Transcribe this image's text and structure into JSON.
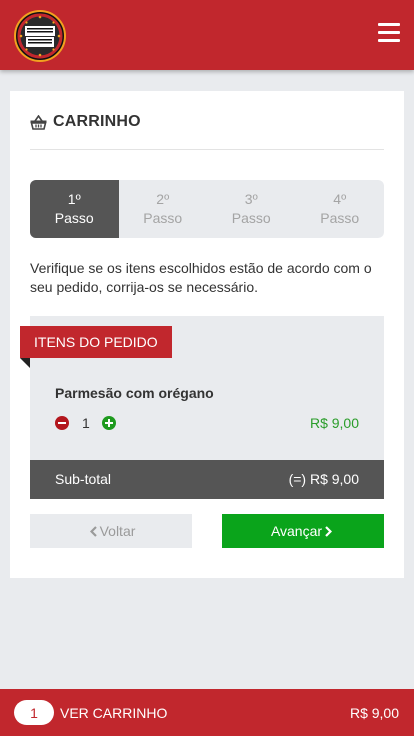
{
  "header": {
    "logo_text": "PAPA JOE'S",
    "menu_icon": "hamburger-menu-icon"
  },
  "cart": {
    "title": "CARRINHO",
    "title_icon": "basket-icon"
  },
  "steps": [
    {
      "number": "1º",
      "label": "Passo",
      "active": true
    },
    {
      "number": "2º",
      "label": "Passo",
      "active": false
    },
    {
      "number": "3º",
      "label": "Passo",
      "active": false
    },
    {
      "number": "4º",
      "label": "Passo",
      "active": false
    }
  ],
  "intro_text": "Verifique se os itens escolhidos estão de acordo com o seu pedido, corrija-os se necessário.",
  "order": {
    "section_label": "ITENS DO PEDIDO",
    "items": [
      {
        "name": "Parmesão com orégano",
        "quantity": "1",
        "price": "R$ 9,00"
      }
    ],
    "subtotal_label": "Sub-total",
    "subtotal_value": "(=) R$ 9,00"
  },
  "actions": {
    "back_label": "Voltar",
    "next_label": "Avançar"
  },
  "bottom_bar": {
    "count": "1",
    "label": "VER CARRINHO",
    "total": "R$ 9,00"
  },
  "colors": {
    "brand_red": "#c1272d",
    "active_step": "#555555",
    "success_green": "#0aa41b",
    "price_green": "#2a9d2a"
  }
}
